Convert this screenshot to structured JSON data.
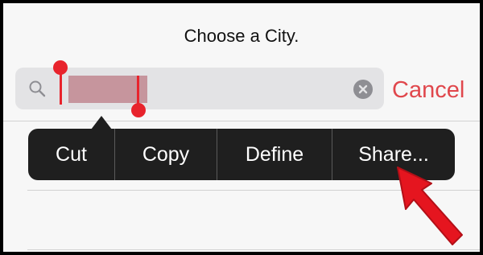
{
  "nav": {
    "title": "Choose a City."
  },
  "search": {
    "selected_text": "",
    "clear_icon": "clear-x-icon",
    "search_icon": "magnifier-icon"
  },
  "cancel_label": "Cancel",
  "edit_menu": {
    "items": [
      {
        "label": "Cut"
      },
      {
        "label": "Copy"
      },
      {
        "label": "Define"
      },
      {
        "label": "Share..."
      }
    ]
  },
  "colors": {
    "accent_red": "#e0474c",
    "selection_handle": "#e8232c",
    "selection_fill": "#c6959d",
    "menu_bg": "#1f1f1f",
    "pointer_arrow": "#e5151f"
  }
}
